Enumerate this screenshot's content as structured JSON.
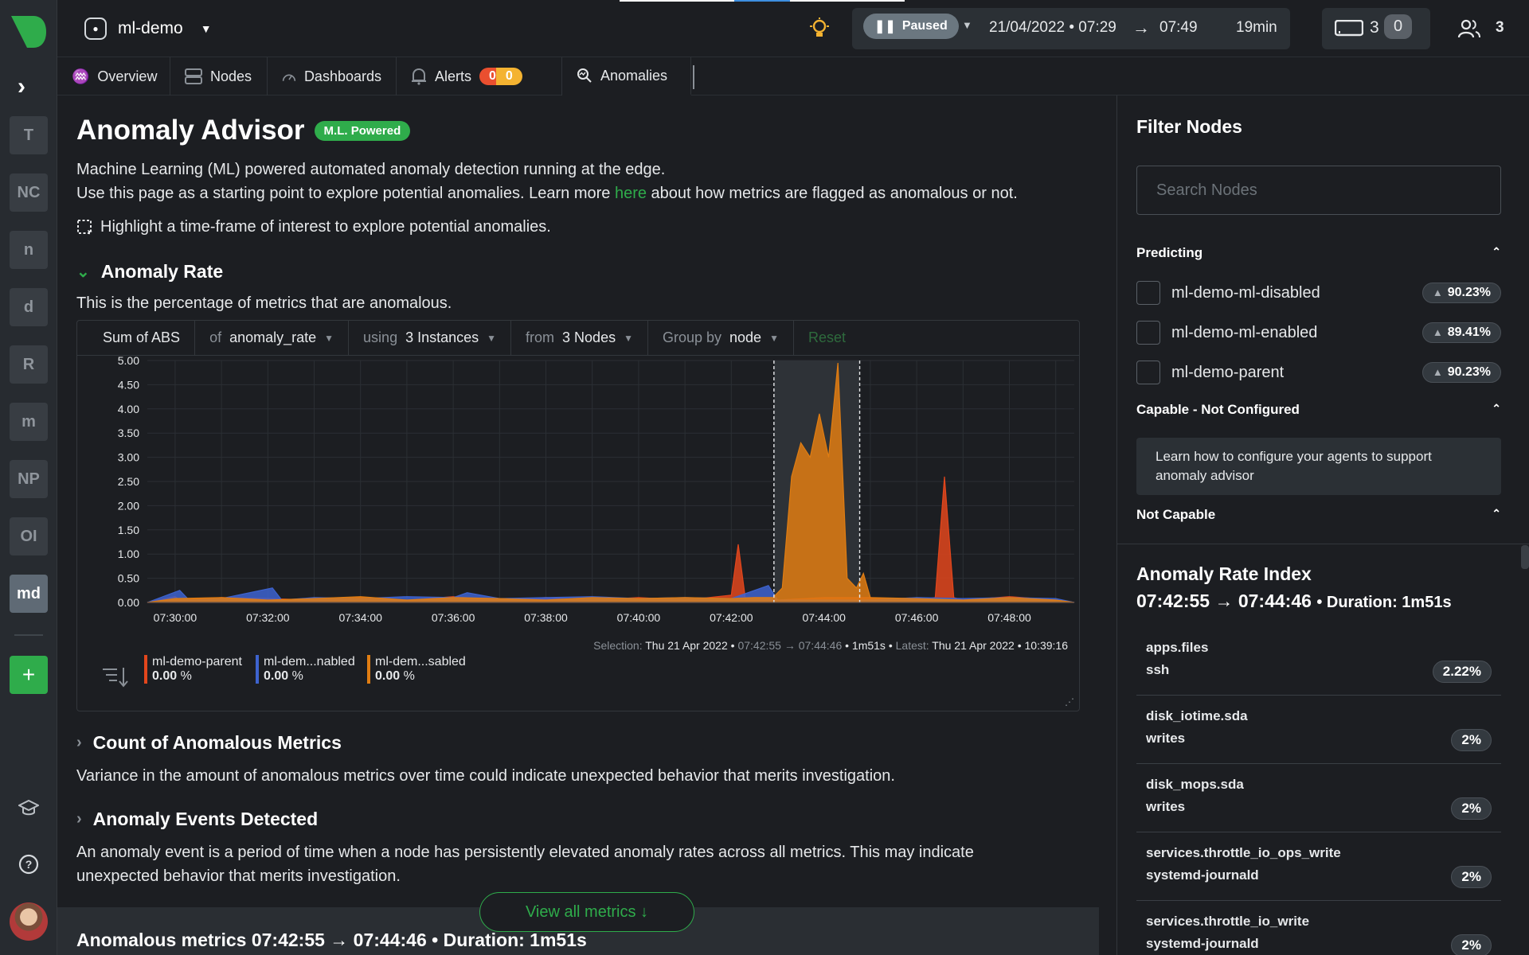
{
  "sidebar": {
    "workspaces": [
      {
        "label": "T"
      },
      {
        "label": "NC"
      },
      {
        "label": "n"
      },
      {
        "label": "d"
      },
      {
        "label": "R"
      },
      {
        "label": "m"
      },
      {
        "label": "NP"
      },
      {
        "label": "OI"
      },
      {
        "label": "md"
      }
    ],
    "add_label": "+"
  },
  "topbar": {
    "room": "ml-demo",
    "status": "Paused",
    "range_start": "21/04/2022 • 07:29",
    "arrow": "→",
    "range_end": "07:49",
    "duration": "19min",
    "nodes_count": "3",
    "nodes_zero": "0",
    "users_count": "3"
  },
  "tabs": {
    "overview": "Overview",
    "nodes": "Nodes",
    "dashboards": "Dashboards",
    "alerts": "Alerts",
    "alerts_critical": "0",
    "alerts_warning": "0",
    "anomalies": "Anomalies"
  },
  "main": {
    "title": "Anomaly Advisor",
    "badge": "M.L. Powered",
    "desc1": "Machine Learning (ML) powered automated anomaly detection running at the edge.",
    "desc2_a": "Use this page as a starting point to explore potential anomalies. Learn more ",
    "desc2_link": "here",
    "desc2_b": " about how metrics are flagged as anomalous or not.",
    "highlight": "Highlight a time-frame of interest to explore potential anomalies.",
    "sec_rate": "Anomaly Rate",
    "sec_rate_desc": "This is the percentage of metrics that are anomalous.",
    "sec_count": "Count of Anomalous Metrics",
    "sec_count_desc": "Variance in the amount of anomalous metrics over time could indicate unexpected behavior that merits investigation.",
    "sec_events": "Anomaly Events Detected",
    "sec_events_desc1": "An anomaly event is a period of time when a node has persistently elevated anomaly rates across all metrics. This may indicate",
    "sec_events_desc2": "unexpected behavior that merits investigation.",
    "view_all": "View all metrics ↓",
    "bottom_title": "Anomalous metrics 07:42:55 → 07:44:46 • Duration: 1m51s"
  },
  "chart_toolbar": {
    "agg": "Sum of ABS",
    "of_label": "of",
    "of_value": "anomaly_rate",
    "using_label": "using",
    "using_value": "3 Instances",
    "from_label": "from",
    "from_value": "3 Nodes",
    "group_label": "Group by",
    "group_value": "node",
    "reset": "Reset"
  },
  "selection": {
    "sel_label": "Selection:",
    "sel_date": "Thu 21 Apr 2022 •",
    "sel_range": "07:42:55 → 07:44:46",
    "sel_dur": "• 1m51s •",
    "latest_label": "Latest:",
    "latest_value": "Thu 21 Apr 2022 • 10:39:16"
  },
  "legend": [
    {
      "name": "ml-demo-parent",
      "value": "0.00",
      "unit": "%",
      "color": "#e2461c"
    },
    {
      "name": "ml-dem...nabled",
      "value": "0.00",
      "unit": "%",
      "color": "#3d63cf"
    },
    {
      "name": "ml-dem...sabled",
      "value": "0.00",
      "unit": "%",
      "color": "#e07d12"
    }
  ],
  "chart_data": {
    "type": "area",
    "title": "",
    "xlabel": "",
    "ylabel": "",
    "ylim": [
      0,
      5
    ],
    "yticks": [
      "0.00",
      "0.50",
      "1.00",
      "1.50",
      "2.00",
      "2.50",
      "3.00",
      "3.50",
      "4.00",
      "4.50",
      "5.00"
    ],
    "x_ticks": [
      "07:30:00",
      "07:32:00",
      "07:34:00",
      "07:36:00",
      "07:38:00",
      "07:40:00",
      "07:42:00",
      "07:44:00",
      "07:46:00",
      "07:48:00"
    ],
    "x_range_minutes": [
      29.4,
      49.4
    ],
    "selection_minutes": [
      42.92,
      44.77
    ],
    "series": [
      {
        "name": "ml-demo-parent",
        "color": "#e2461c",
        "points": [
          [
            29.4,
            0
          ],
          [
            30,
            0.12
          ],
          [
            30.1,
            0.05
          ],
          [
            31,
            0.1
          ],
          [
            32,
            0.08
          ],
          [
            33,
            0.05
          ],
          [
            34,
            0.1
          ],
          [
            35,
            0.05
          ],
          [
            36,
            0.12
          ],
          [
            37,
            0.05
          ],
          [
            38,
            0.1
          ],
          [
            39,
            0.05
          ],
          [
            40,
            0.1
          ],
          [
            41,
            0.05
          ],
          [
            42,
            0.15
          ],
          [
            42.15,
            1.2
          ],
          [
            42.3,
            0.1
          ],
          [
            42.6,
            0.1
          ],
          [
            43,
            0.05
          ],
          [
            44,
            0.1
          ],
          [
            45,
            0.1
          ],
          [
            46,
            0.05
          ],
          [
            46.4,
            0.1
          ],
          [
            46.6,
            2.6
          ],
          [
            46.8,
            0.1
          ],
          [
            47,
            0.05
          ],
          [
            48,
            0.12
          ],
          [
            49,
            0.05
          ],
          [
            49.4,
            0
          ]
        ]
      },
      {
        "name": "ml-dem...nabled",
        "color": "#3d63cf",
        "points": [
          [
            29.4,
            0
          ],
          [
            30.1,
            0.25
          ],
          [
            30.3,
            0.05
          ],
          [
            31,
            0.08
          ],
          [
            32.1,
            0.3
          ],
          [
            32.3,
            0.05
          ],
          [
            33,
            0.1
          ],
          [
            34,
            0.08
          ],
          [
            35,
            0.12
          ],
          [
            36,
            0.1
          ],
          [
            36.3,
            0.2
          ],
          [
            37,
            0.08
          ],
          [
            38,
            0.1
          ],
          [
            39,
            0.12
          ],
          [
            40,
            0.08
          ],
          [
            41,
            0.1
          ],
          [
            42,
            0.08
          ],
          [
            42.8,
            0.35
          ],
          [
            43,
            0.05
          ],
          [
            44,
            0.05
          ],
          [
            45,
            0.05
          ],
          [
            46,
            0.1
          ],
          [
            47,
            0.08
          ],
          [
            48,
            0.1
          ],
          [
            49,
            0.08
          ],
          [
            49.4,
            0
          ]
        ]
      },
      {
        "name": "ml-dem...sabled",
        "color": "#e07d12",
        "points": [
          [
            29.4,
            0
          ],
          [
            30,
            0.08
          ],
          [
            31,
            0.1
          ],
          [
            32,
            0.05
          ],
          [
            33,
            0.08
          ],
          [
            34,
            0.12
          ],
          [
            35,
            0.05
          ],
          [
            36,
            0.1
          ],
          [
            37,
            0.08
          ],
          [
            38,
            0.05
          ],
          [
            39,
            0.1
          ],
          [
            40,
            0.08
          ],
          [
            41,
            0.1
          ],
          [
            42,
            0.08
          ],
          [
            42.5,
            0.1
          ],
          [
            42.9,
            0.1
          ],
          [
            43.1,
            0.3
          ],
          [
            43.3,
            2.6
          ],
          [
            43.5,
            3.3
          ],
          [
            43.7,
            3.0
          ],
          [
            43.9,
            3.9
          ],
          [
            44.1,
            3.0
          ],
          [
            44.3,
            4.95
          ],
          [
            44.5,
            0.5
          ],
          [
            44.7,
            0.3
          ],
          [
            44.85,
            0.6
          ],
          [
            45,
            0.1
          ],
          [
            46,
            0.08
          ],
          [
            47,
            0.05
          ],
          [
            48,
            0.1
          ],
          [
            49,
            0.05
          ],
          [
            49.4,
            0
          ]
        ]
      }
    ]
  },
  "filter": {
    "title": "Filter Nodes",
    "search_placeholder": "Search Nodes",
    "predicting": "Predicting",
    "nodes": [
      {
        "name": "ml-demo-ml-disabled",
        "rate": "90.23%"
      },
      {
        "name": "ml-demo-ml-enabled",
        "rate": "89.41%"
      },
      {
        "name": "ml-demo-parent",
        "rate": "90.23%"
      }
    ],
    "capable": "Capable - Not Configured",
    "capable_info": "Learn how to configure your agents to support anomaly advisor",
    "not_capable": "Not Capable"
  },
  "index": {
    "title": "Anomaly Rate Index",
    "range": "07:42:55 → 07:44:46",
    "duration": "• Duration: 1m51s",
    "rows": [
      {
        "chart": "apps.files",
        "dim": "ssh",
        "value": "2.22%"
      },
      {
        "chart": "disk_iotime.sda",
        "dim": "writes",
        "value": "2%"
      },
      {
        "chart": "disk_mops.sda",
        "dim": "writes",
        "value": "2%"
      },
      {
        "chart": "services.throttle_io_ops_write",
        "dim": "systemd-journald",
        "value": "2%"
      },
      {
        "chart": "services.throttle_io_write",
        "dim": "systemd-journald",
        "value": "2%"
      }
    ]
  }
}
